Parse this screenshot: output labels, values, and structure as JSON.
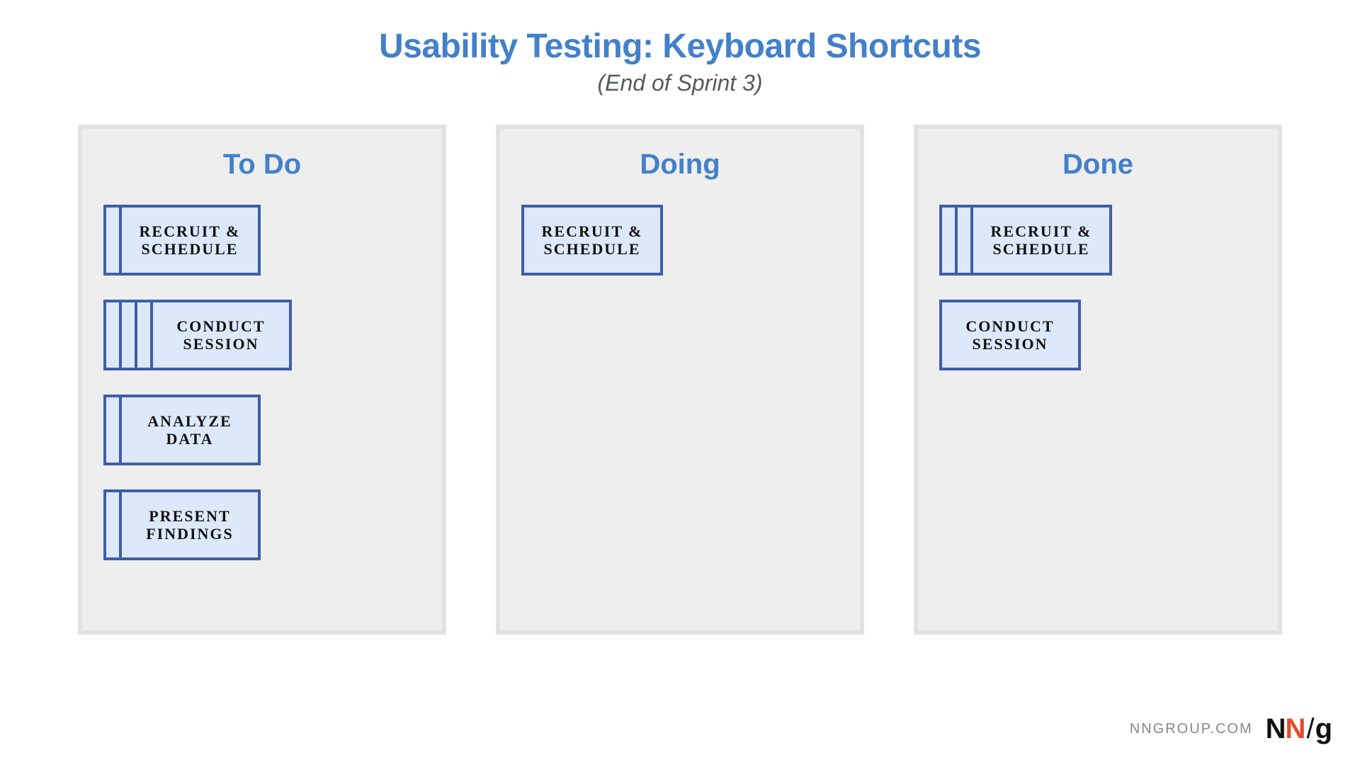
{
  "header": {
    "title": "Usability Testing: Keyboard Shortcuts",
    "subtitle": "(End of Sprint 3)"
  },
  "columns": [
    {
      "title": "To Do",
      "stacks": [
        {
          "label": "Recruit & Schedule",
          "count": 2
        },
        {
          "label": "Conduct Session",
          "count": 4
        },
        {
          "label": "Analyze Data",
          "count": 2
        },
        {
          "label": "Present Findings",
          "count": 2
        }
      ]
    },
    {
      "title": "Doing",
      "stacks": [
        {
          "label": "Recruit & Schedule",
          "count": 1
        }
      ]
    },
    {
      "title": "Done",
      "stacks": [
        {
          "label": "Recruit & Schedule",
          "count": 3
        },
        {
          "label": "Conduct Session",
          "count": 1
        }
      ]
    }
  ],
  "footer": {
    "site": "NNGROUP.COM",
    "logo": {
      "n1": "N",
      "n2": "N",
      "slash": "/",
      "g": "g"
    }
  },
  "colors": {
    "accent": "#4380c9",
    "card_border": "#3f5ea8",
    "card_fill": "#dde9fb",
    "column_bg": "#eeeeee"
  }
}
